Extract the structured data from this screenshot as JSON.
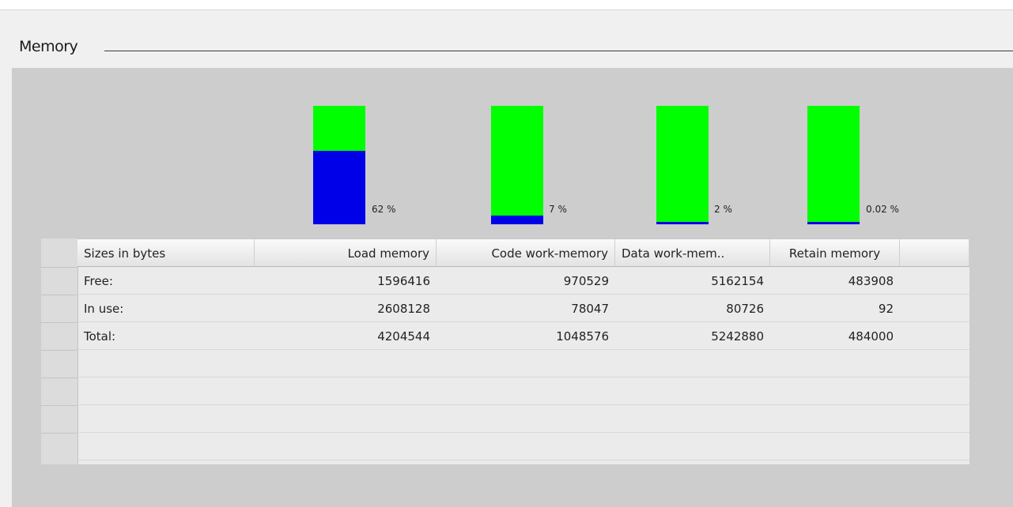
{
  "section": {
    "title": "Memory"
  },
  "gauges": [
    {
      "percent_label": "62 %",
      "fill_fraction": 0.62,
      "name": "load"
    },
    {
      "percent_label": "7 %",
      "fill_fraction": 0.07,
      "name": "code"
    },
    {
      "percent_label": "2 %",
      "fill_fraction": 0.02,
      "name": "data"
    },
    {
      "percent_label": "0.02 %",
      "fill_fraction": 0.0002,
      "name": "retain"
    }
  ],
  "colors": {
    "free": "#00ff00",
    "used": "#0000e8",
    "panel": "#cdcdcd"
  },
  "table": {
    "headers": [
      "Sizes in bytes",
      "Load memory",
      "Code work-memory",
      "Data work-mem..",
      "Retain memory"
    ],
    "rows": [
      [
        "Free:",
        "1596416",
        "970529",
        "5162154",
        "483908"
      ],
      [
        "In use:",
        "2608128",
        "78047",
        "80726",
        "92"
      ],
      [
        "Total:",
        "4204544",
        "1048576",
        "5242880",
        "484000"
      ]
    ]
  }
}
